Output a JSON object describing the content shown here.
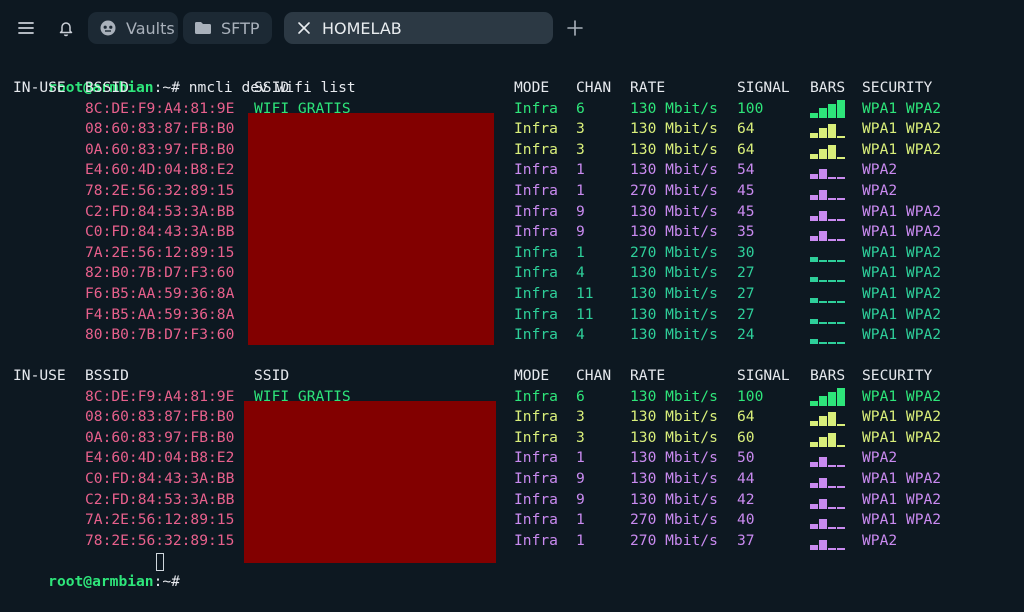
{
  "tabs": [
    {
      "label": "Vaults",
      "icon": "vault-icon",
      "active": false
    },
    {
      "label": "SFTP",
      "icon": "folder-icon",
      "active": false
    },
    {
      "label": "HOMELAB",
      "icon": "close-icon",
      "active": true
    }
  ],
  "colors": {
    "prompt": "#2ee57a",
    "bssid": "#e8608c",
    "ssid": "#2ee57a",
    "green": "#2ee57a",
    "yellow": "#d9ef7a",
    "purple": "#c98af0",
    "teal": "#2ecf9a",
    "redaction": "#820000",
    "background": "#0d1821"
  },
  "terminal": {
    "prompt_user": "root@armbian",
    "prompt_path": ":~#",
    "command": "nmcli dev wifi list",
    "headers": {
      "in_use": "IN-USE",
      "bssid": "BSSID",
      "ssid": "SSID",
      "mode": "MODE",
      "chan": "CHAN",
      "rate": "RATE",
      "signal": "SIGNAL",
      "bars": "BARS",
      "security": "SECURITY"
    },
    "blocks": [
      {
        "rows": [
          {
            "bssid": "8C:DE:F9:A4:81:9E",
            "ssid": "WIFI GRATIS",
            "mode": "Infra",
            "chan": "6",
            "rate": "130 Mbit/s",
            "signal": "100",
            "bars": 4,
            "security": "WPA1 WPA2",
            "color": "green"
          },
          {
            "bssid": "08:60:83:87:FB:B0",
            "ssid": "",
            "mode": "Infra",
            "chan": "3",
            "rate": "130 Mbit/s",
            "signal": "64",
            "bars": 3,
            "security": "WPA1 WPA2",
            "color": "yellow"
          },
          {
            "bssid": "0A:60:83:97:FB:B0",
            "ssid": "",
            "mode": "Infra",
            "chan": "3",
            "rate": "130 Mbit/s",
            "signal": "64",
            "bars": 3,
            "security": "WPA1 WPA2",
            "color": "yellow"
          },
          {
            "bssid": "E4:60:4D:04:B8:E2",
            "ssid": "",
            "mode": "Infra",
            "chan": "1",
            "rate": "130 Mbit/s",
            "signal": "54",
            "bars": 2,
            "security": "WPA2",
            "color": "purple"
          },
          {
            "bssid": "78:2E:56:32:89:15",
            "ssid": "",
            "mode": "Infra",
            "chan": "1",
            "rate": "270 Mbit/s",
            "signal": "45",
            "bars": 2,
            "security": "WPA2",
            "color": "purple"
          },
          {
            "bssid": "C2:FD:84:53:3A:BB",
            "ssid": "",
            "mode": "Infra",
            "chan": "9",
            "rate": "130 Mbit/s",
            "signal": "45",
            "bars": 2,
            "security": "WPA1 WPA2",
            "color": "purple"
          },
          {
            "bssid": "C0:FD:84:43:3A:BB",
            "ssid": "",
            "mode": "Infra",
            "chan": "9",
            "rate": "130 Mbit/s",
            "signal": "35",
            "bars": 2,
            "security": "WPA1 WPA2",
            "color": "purple"
          },
          {
            "bssid": "7A:2E:56:12:89:15",
            "ssid": "",
            "mode": "Infra",
            "chan": "1",
            "rate": "270 Mbit/s",
            "signal": "30",
            "bars": 1,
            "security": "WPA1 WPA2",
            "color": "teal"
          },
          {
            "bssid": "82:B0:7B:D7:F3:60",
            "ssid": "",
            "mode": "Infra",
            "chan": "4",
            "rate": "130 Mbit/s",
            "signal": "27",
            "bars": 1,
            "security": "WPA1 WPA2",
            "color": "teal"
          },
          {
            "bssid": "F6:B5:AA:59:36:8A",
            "ssid": "",
            "mode": "Infra",
            "chan": "11",
            "rate": "130 Mbit/s",
            "signal": "27",
            "bars": 1,
            "security": "WPA1 WPA2",
            "color": "teal"
          },
          {
            "bssid": "F4:B5:AA:59:36:8A",
            "ssid": "",
            "mode": "Infra",
            "chan": "11",
            "rate": "130 Mbit/s",
            "signal": "27",
            "bars": 1,
            "security": "WPA1 WPA2",
            "color": "teal"
          },
          {
            "bssid": "80:B0:7B:D7:F3:60",
            "ssid": "",
            "mode": "Infra",
            "chan": "4",
            "rate": "130 Mbit/s",
            "signal": "24",
            "bars": 1,
            "security": "WPA1 WPA2",
            "color": "teal"
          }
        ]
      },
      {
        "rows": [
          {
            "bssid": "8C:DE:F9:A4:81:9E",
            "ssid": "WIFI GRATIS",
            "mode": "Infra",
            "chan": "6",
            "rate": "130 Mbit/s",
            "signal": "100",
            "bars": 4,
            "security": "WPA1 WPA2",
            "color": "green"
          },
          {
            "bssid": "08:60:83:87:FB:B0",
            "ssid": "",
            "mode": "Infra",
            "chan": "3",
            "rate": "130 Mbit/s",
            "signal": "64",
            "bars": 3,
            "security": "WPA1 WPA2",
            "color": "yellow"
          },
          {
            "bssid": "0A:60:83:97:FB:B0",
            "ssid": "",
            "mode": "Infra",
            "chan": "3",
            "rate": "130 Mbit/s",
            "signal": "60",
            "bars": 3,
            "security": "WPA1 WPA2",
            "color": "yellow"
          },
          {
            "bssid": "E4:60:4D:04:B8:E2",
            "ssid": "",
            "mode": "Infra",
            "chan": "1",
            "rate": "130 Mbit/s",
            "signal": "50",
            "bars": 2,
            "security": "WPA2",
            "color": "purple"
          },
          {
            "bssid": "C0:FD:84:43:3A:BB",
            "ssid": "",
            "mode": "Infra",
            "chan": "9",
            "rate": "130 Mbit/s",
            "signal": "44",
            "bars": 2,
            "security": "WPA1 WPA2",
            "color": "purple"
          },
          {
            "bssid": "C2:FD:84:53:3A:BB",
            "ssid": "",
            "mode": "Infra",
            "chan": "9",
            "rate": "130 Mbit/s",
            "signal": "42",
            "bars": 2,
            "security": "WPA1 WPA2",
            "color": "purple"
          },
          {
            "bssid": "7A:2E:56:12:89:15",
            "ssid": "",
            "mode": "Infra",
            "chan": "1",
            "rate": "270 Mbit/s",
            "signal": "40",
            "bars": 2,
            "security": "WPA1 WPA2",
            "color": "purple"
          },
          {
            "bssid": "78:2E:56:32:89:15",
            "ssid": "",
            "mode": "Infra",
            "chan": "1",
            "rate": "270 Mbit/s",
            "signal": "37",
            "bars": 2,
            "security": "WPA2",
            "color": "purple"
          }
        ]
      }
    ]
  }
}
